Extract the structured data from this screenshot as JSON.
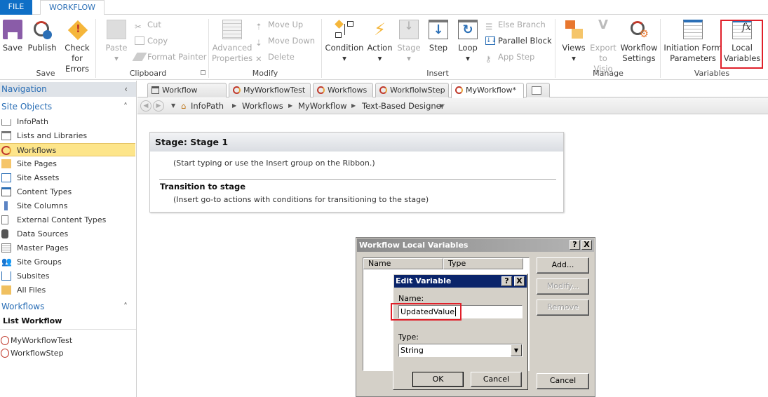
{
  "ribbon_tabs": {
    "file": "FILE",
    "workflow": "WORKFLOW"
  },
  "ribbon": {
    "save": "Save",
    "publish": "Publish",
    "check_errors_1": "Check",
    "check_errors_2": "for Errors",
    "paste": "Paste",
    "cut": "Cut",
    "copy": "Copy",
    "format_painter": "Format Painter",
    "adv_props_1": "Advanced",
    "adv_props_2": "Properties",
    "move_up": "Move Up",
    "move_down": "Move Down",
    "delete": "Delete",
    "condition": "Condition",
    "action": "Action",
    "stage": "Stage",
    "step": "Step",
    "loop": "Loop",
    "else_branch": "Else Branch",
    "parallel_block": "Parallel Block",
    "app_step": "App Step",
    "views": "Views",
    "export_1": "Export",
    "export_2": "to Visio",
    "wf_settings_1": "Workflow",
    "wf_settings_2": "Settings",
    "init_form_1": "Initiation Form",
    "init_form_2": "Parameters",
    "local_vars_1": "Local",
    "local_vars_2": "Variables",
    "groups": {
      "save": "Save",
      "clipboard": "Clipboard",
      "modify": "Modify",
      "insert": "Insert",
      "manage": "Manage",
      "variables": "Variables"
    }
  },
  "navigation": {
    "title": "Navigation",
    "site_objects": "Site Objects",
    "items": [
      "InfoPath",
      "Lists and Libraries",
      "Workflows",
      "Site Pages",
      "Site Assets",
      "Content Types",
      "Site Columns",
      "External Content Types",
      "Data Sources",
      "Master Pages",
      "Site Groups",
      "Subsites",
      "All Files"
    ],
    "selected": "Workflows",
    "workflows_header": "Workflows",
    "list_workflow": "List Workflow",
    "workflow_items": [
      "MyWorkflowTest",
      "WorkflowStep"
    ]
  },
  "doc_tabs": [
    "Workflow History",
    "MyWorkflowTest",
    "Workflows",
    "WorkflolwStep",
    "MyWorkflow*"
  ],
  "breadcrumb": [
    "InfoPath",
    "Workflows",
    "MyWorkflow",
    "Text-Based Designer"
  ],
  "stage": {
    "title": "Stage: Stage 1",
    "hint": "(Start typing or use the Insert group on the Ribbon.)",
    "transition": "Transition to stage",
    "transition_hint": "(Insert go-to actions with conditions for transitioning to the stage)"
  },
  "local_vars_dialog": {
    "title": "Workflow Local Variables",
    "col_name": "Name",
    "col_type": "Type",
    "add": "Add...",
    "modify": "Modify...",
    "remove": "Remove",
    "cancel": "Cancel",
    "help": "?",
    "close": "X"
  },
  "edit_var_dialog": {
    "title": "Edit Variable",
    "name_label": "Name:",
    "name_value": "UpdatedValue",
    "type_label": "Type:",
    "type_value": "String",
    "ok": "OK",
    "cancel": "Cancel",
    "help": "?",
    "close": "X"
  },
  "colors": {
    "accent": "#0f6fc6",
    "highlight": "#fde58a",
    "callout": "#e0202a",
    "dialog_title": "#0a246a"
  }
}
